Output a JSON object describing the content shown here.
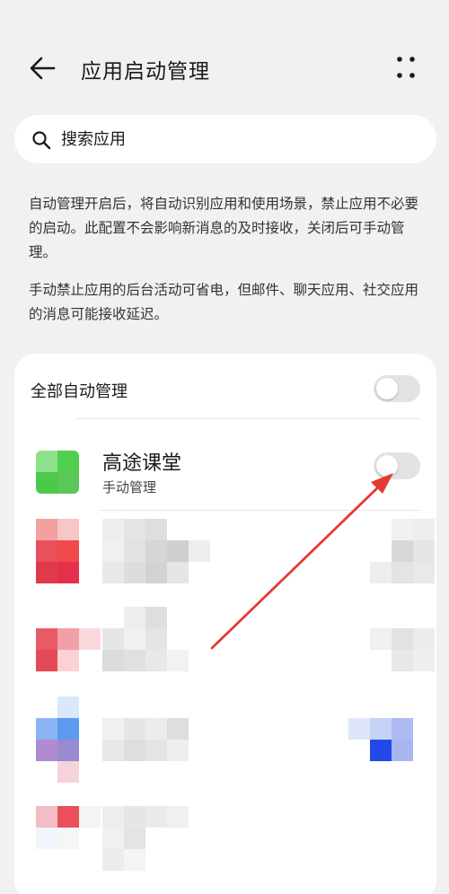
{
  "header": {
    "title": "应用启动管理",
    "back_icon": "arrow-left-icon",
    "more_icon": "more-dots-icon"
  },
  "search": {
    "placeholder": "搜索应用",
    "icon": "search-icon"
  },
  "description": {
    "paragraph1": "自动管理开启后，将自动识别应用和使用场景，禁止应用不必要的启动。此配置不会影响新消息的及时接收，关闭后可手动管理。",
    "paragraph2": "手动禁止应用的后台活动可省电，但邮件、聊天应用、社交应用的消息可能接收延迟。"
  },
  "card": {
    "all_auto_label": "全部自动管理",
    "all_auto_enabled": false,
    "apps": [
      {
        "name": "高途课堂",
        "status": "手动管理",
        "enabled": false
      }
    ]
  },
  "colors": {
    "background": "#f1f1f3",
    "card": "#ffffff",
    "toggle_off": "#e3e3e5",
    "annotation_arrow": "#e53935",
    "app_icon_green": "#4cc94a"
  }
}
